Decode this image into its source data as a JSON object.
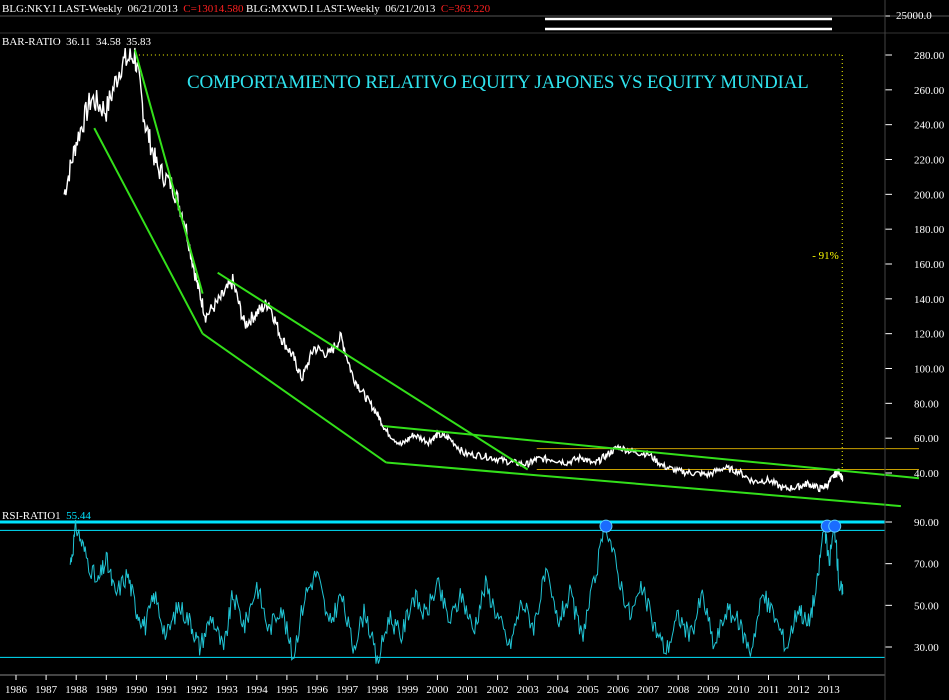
{
  "header": {
    "series1_label": "BLG:NKY.I LAST-Weekly",
    "series1_date": "06/21/2013",
    "series1_close": "C=13014.580",
    "series2_label": "BLG:MXWD.I LAST-Weekly",
    "series2_date": "06/21/2013",
    "series2_close": "C=363.220",
    "top_axis_label": "25000.0"
  },
  "colors": {
    "background": "#000000",
    "price": "#ffffff",
    "trendline": "#33e01a",
    "rsi": "#20c4d4",
    "rsi_band": "#00e5ff",
    "reference": "#c8a000",
    "annotation": "#ffff00",
    "marker": "#1a6cff"
  },
  "chart_data": [
    {
      "type": "line",
      "panel": "BAR-RATIO",
      "legend": {
        "name": "BAR-RATIO",
        "values": [
          "36.11",
          "34.58",
          "35.83"
        ]
      },
      "title": "COMPORTAMIENTO RELATIVO EQUITY JAPONES VS EQUITY MUNDIAL",
      "ylim": [
        24,
        290
      ],
      "yticks": [
        "280.00",
        "260.00",
        "240.00",
        "220.00",
        "200.00",
        "180.00",
        "160.00",
        "140.00",
        "120.00",
        "100.00",
        "80.00",
        "60.00",
        "40.00"
      ],
      "x_year_range": [
        1986,
        2013.8
      ],
      "series": [
        {
          "x": [
            1987.6,
            1988.0,
            1988.5,
            1989.0,
            1989.5,
            1989.95,
            1990.3,
            1990.7,
            1991.2,
            1991.6,
            1992.0,
            1992.3,
            1992.8,
            1993.2,
            1993.6,
            1994.0,
            1994.4,
            1994.8,
            1995.2,
            1995.5,
            1995.9,
            1996.4,
            1996.8,
            1997.2,
            1997.6,
            1998.0,
            1998.3,
            1998.8,
            1999.2,
            1999.7,
            2000.0,
            2000.4,
            2000.9,
            2001.5,
            2002.0,
            2002.5,
            2003.0,
            2003.3,
            2003.8,
            2004.3,
            2004.8,
            2005.2,
            2005.6,
            2006.0,
            2006.5,
            2007.0,
            2007.5,
            2008.0,
            2008.5,
            2009.0,
            2009.5,
            2010.0,
            2010.5,
            2011.0,
            2011.5,
            2012.0,
            2012.3,
            2012.7,
            2012.95,
            2013.2,
            2013.35,
            2013.47
          ],
          "y": [
            200,
            230,
            255,
            248,
            275,
            280,
            240,
            215,
            205,
            185,
            150,
            130,
            140,
            150,
            125,
            132,
            138,
            118,
            107,
            94,
            112,
            108,
            118,
            95,
            84,
            74,
            64,
            56,
            62,
            58,
            62,
            60,
            51,
            50,
            48,
            46,
            45,
            48,
            48,
            46,
            49,
            45,
            50,
            55,
            52,
            51,
            44,
            41,
            40,
            39,
            43,
            41,
            35,
            36,
            31,
            32,
            34,
            31,
            33,
            39,
            41,
            36
          ]
        },
        {
          "name": "Trendline 1 (upper)",
          "x": [
            1989.95,
            1992.2
          ],
          "y": [
            283,
            143
          ]
        },
        {
          "name": "Trendline 1 (lower)",
          "x": [
            1988.6,
            1992.2
          ],
          "y": [
            238,
            120
          ]
        },
        {
          "name": "Channel 2 (upper)",
          "x": [
            1992.7,
            2003.0
          ],
          "y": [
            155,
            42
          ]
        },
        {
          "name": "Channel 2 (lower)",
          "x": [
            1992.2,
            1998.3
          ],
          "y": [
            120,
            46
          ]
        },
        {
          "name": "Channel 3 (upper)",
          "x": [
            1998.2,
            2016.0
          ],
          "y": [
            67,
            37
          ]
        },
        {
          "name": "Channel 3 (lower)",
          "x": [
            1998.3,
            2015.4
          ],
          "y": [
            46,
            21
          ]
        }
      ],
      "reference_lines": [
        {
          "y": 54
        },
        {
          "y": 42
        }
      ],
      "annotations": [
        {
          "text": "- 91%",
          "x": 2013.45,
          "y": 163
        }
      ]
    },
    {
      "type": "line",
      "panel": "RSI-RATIO1",
      "legend": {
        "name": "RSI-RATIO1",
        "value": "55.44"
      },
      "ylim": [
        20,
        96
      ],
      "yticks": [
        "90.00",
        "70.00",
        "50.00",
        "30.00"
      ],
      "bands": [
        90,
        86,
        25
      ],
      "series": [
        {
          "x": [
            1987.8,
            1988.0,
            1988.3,
            1988.7,
            1989.0,
            1989.3,
            1989.7,
            1990.0,
            1990.3,
            1990.6,
            1991.0,
            1991.4,
            1991.8,
            1992.1,
            1992.5,
            1992.9,
            1993.2,
            1993.6,
            1994.0,
            1994.4,
            1994.8,
            1995.2,
            1995.6,
            1996.0,
            1996.4,
            1996.8,
            1997.2,
            1997.6,
            1998.0,
            1998.4,
            1998.8,
            1999.2,
            1999.6,
            2000.0,
            2000.4,
            2000.8,
            2001.2,
            2001.6,
            2002.0,
            2002.4,
            2002.8,
            2003.2,
            2003.6,
            2004.0,
            2004.4,
            2004.8,
            2005.2,
            2005.6,
            2006.0,
            2006.4,
            2006.8,
            2007.2,
            2007.6,
            2008.0,
            2008.4,
            2008.8,
            2009.2,
            2009.6,
            2010.0,
            2010.4,
            2010.8,
            2011.2,
            2011.6,
            2012.0,
            2012.3,
            2012.6,
            2012.85,
            2013.0,
            2013.2,
            2013.35,
            2013.47
          ],
          "y": [
            70,
            88,
            75,
            60,
            72,
            55,
            65,
            48,
            40,
            55,
            35,
            50,
            42,
            30,
            45,
            28,
            55,
            40,
            60,
            38,
            50,
            25,
            55,
            66,
            40,
            55,
            30,
            48,
            22,
            45,
            35,
            55,
            45,
            60,
            42,
            55,
            38,
            60,
            45,
            30,
            52,
            40,
            65,
            42,
            55,
            35,
            60,
            90,
            65,
            45,
            58,
            40,
            28,
            45,
            35,
            55,
            30,
            48,
            42,
            28,
            55,
            45,
            30,
            50,
            40,
            58,
            90,
            70,
            88,
            60,
            55.44
          ]
        }
      ],
      "markers": [
        {
          "x": 2005.6,
          "y": 88
        },
        {
          "x": 2012.95,
          "y": 88
        },
        {
          "x": 2013.2,
          "y": 88
        }
      ]
    }
  ],
  "x_axis": {
    "years": [
      "1986",
      "1987",
      "1988",
      "1989",
      "1990",
      "1991",
      "1992",
      "1993",
      "1994",
      "1995",
      "1996",
      "1997",
      "1998",
      "1999",
      "2000",
      "2001",
      "2002",
      "2003",
      "2004",
      "2005",
      "2006",
      "2007",
      "2008",
      "2009",
      "2010",
      "2011",
      "2012",
      "2013"
    ]
  }
}
